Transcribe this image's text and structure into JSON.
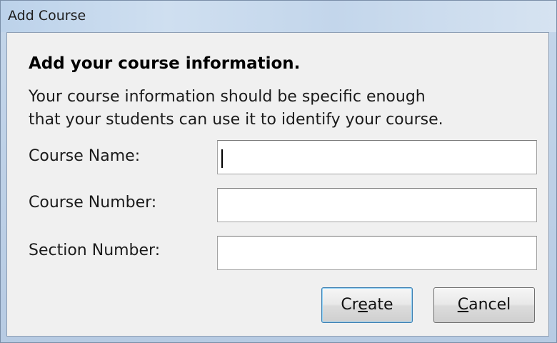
{
  "window": {
    "title": "Add Course"
  },
  "dialog": {
    "heading": "Add your course information.",
    "description_lines": [
      "Your course information should be specific enough",
      "that your students can use it to identify your course."
    ]
  },
  "form": {
    "fields": [
      {
        "label": "Course Name:",
        "value": ""
      },
      {
        "label": "Course Number:",
        "value": ""
      },
      {
        "label": "Section Number:",
        "value": ""
      }
    ]
  },
  "buttons": {
    "create": {
      "pre": "Cr",
      "mnemonic": "e",
      "post": "ate"
    },
    "cancel": {
      "pre": "",
      "mnemonic": "C",
      "post": "ancel"
    }
  }
}
